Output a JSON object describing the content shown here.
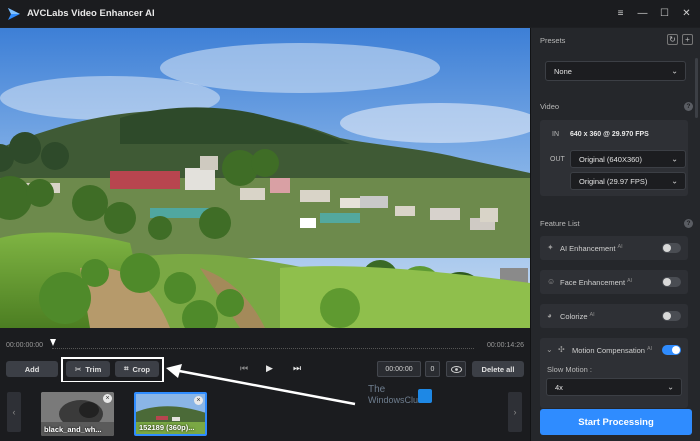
{
  "app": {
    "title": "AVCLabs Video Enhancer AI"
  },
  "window_controls": {
    "menu": "≡",
    "minimize": "—",
    "maximize": "☐",
    "close": "✕"
  },
  "timeline": {
    "start": "00:00:00:00",
    "end": "00:00:14:26"
  },
  "controls": {
    "add": "Add",
    "trim": "Trim",
    "crop": "Crop",
    "timecode": "00:00:00",
    "frame": "0",
    "delete_all": "Delete all"
  },
  "thumbnails": [
    {
      "label": "black_and_wh..."
    },
    {
      "label": "152189 (360p)..."
    }
  ],
  "watermark": {
    "line1": "The",
    "line2": "WindowsClub"
  },
  "panel": {
    "presets": {
      "label": "Presets",
      "value": "None"
    },
    "video": {
      "label": "Video",
      "in_label": "IN",
      "in_value": "640 x 360 @ 29.970 FPS",
      "out_label": "OUT",
      "out_resolution": "Original (640X360)",
      "out_fps": "Original (29.97 FPS)"
    },
    "feature_list": {
      "label": "Feature List",
      "items": [
        {
          "label": "AI Enhancement",
          "ai": "AI",
          "on": false
        },
        {
          "label": "Face Enhancement",
          "ai": "AI",
          "on": false
        },
        {
          "label": "Colorize",
          "ai": "AI",
          "on": false
        }
      ],
      "motion": {
        "label": "Motion Compensation",
        "ai": "AI",
        "on": true,
        "slow_motion_label": "Slow Motion :",
        "slow_motion_value": "4x"
      }
    },
    "start_button": "Start Processing"
  },
  "colors": {
    "accent": "#2f8cff",
    "background": "#1e1f22",
    "panel": "#25272b"
  }
}
